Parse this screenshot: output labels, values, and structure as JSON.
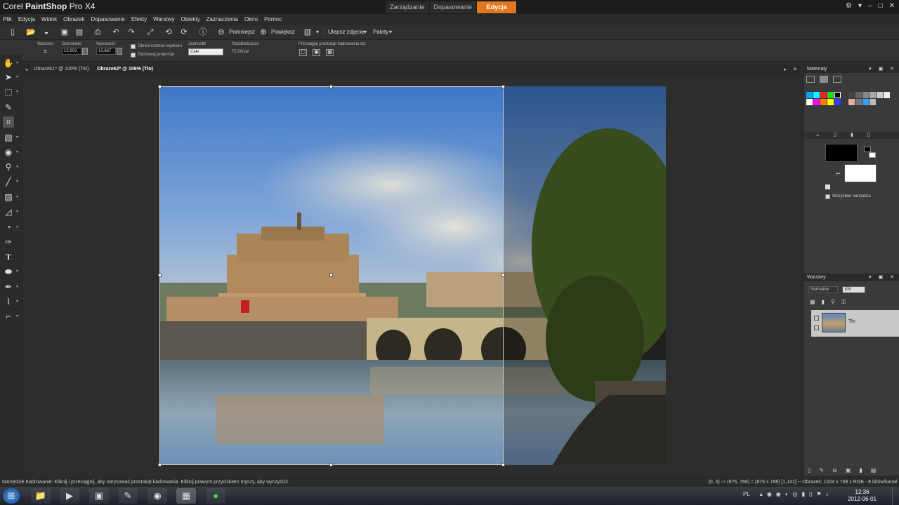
{
  "app": {
    "title_prefix": "Corel ",
    "title_bold": "PaintShop",
    "title_suffix": " Pro X4"
  },
  "workspace_tabs": [
    {
      "label": "Zarządzanie",
      "active": false
    },
    {
      "label": "Dopasowanie",
      "active": false
    },
    {
      "label": "Edycja",
      "active": true
    }
  ],
  "menu": [
    "Plik",
    "Edycja",
    "Widok",
    "Obrazek",
    "Dopasowanie",
    "Efekty",
    "Warstwy",
    "Obiekty",
    "Zaznaczenia",
    "Okno",
    "Pomoc"
  ],
  "toolbar": {
    "zoom_out": "Pomniejsz",
    "zoom_in": "Powiększ",
    "enhance": "Ulepsz zdjęcie",
    "palettes": "Palety"
  },
  "options": {
    "preset_label": "Wzorzec",
    "width_label": "Szerokość",
    "width_value": "12,903",
    "height_label": "Wysokość",
    "height_value": "10,667",
    "print_size_label": "Określ rozmiar wydruku",
    "keep_ratio_label": "Zachowaj proporcje",
    "units_label": "Jednostki",
    "units_value": "Cale",
    "resolution_label": "Rozdzielczość",
    "resolution_value": "72,00/cal",
    "snap_label": "Przyciągaj prostokąt kadrowania do:"
  },
  "doc_tabs": [
    {
      "label": "Obrazek1* @ 100% (Tło)",
      "active": false
    },
    {
      "label": "Obrazek2* @ 106% (Tło)",
      "active": true
    }
  ],
  "materials": {
    "title": "Materiały",
    "all_tools": "Wszystkie narzędzia"
  },
  "layers": {
    "title": "Warstwy",
    "blend_mode": "Normalne",
    "opacity": "100",
    "layer_name": "Tło"
  },
  "status": {
    "left": "Narzędzie Kadrowanie: Kliknij i przeciągnij, aby narysować prostokąt kadrowania. Kliknij prawym przyciskiem myszy, aby wyczyścić.",
    "right": "(0, 0) -> (876, 768) = (876 x 768) [1,141] -- Obrazek: 1024 x 768 x RGB - 8 bitów/kanał"
  },
  "taskbar": {
    "lang": "PL",
    "time": "12:36",
    "date": "2012-06-01"
  },
  "colors": {
    "accent": "#e07820",
    "fg": "#000000",
    "bg": "#ffffff"
  }
}
